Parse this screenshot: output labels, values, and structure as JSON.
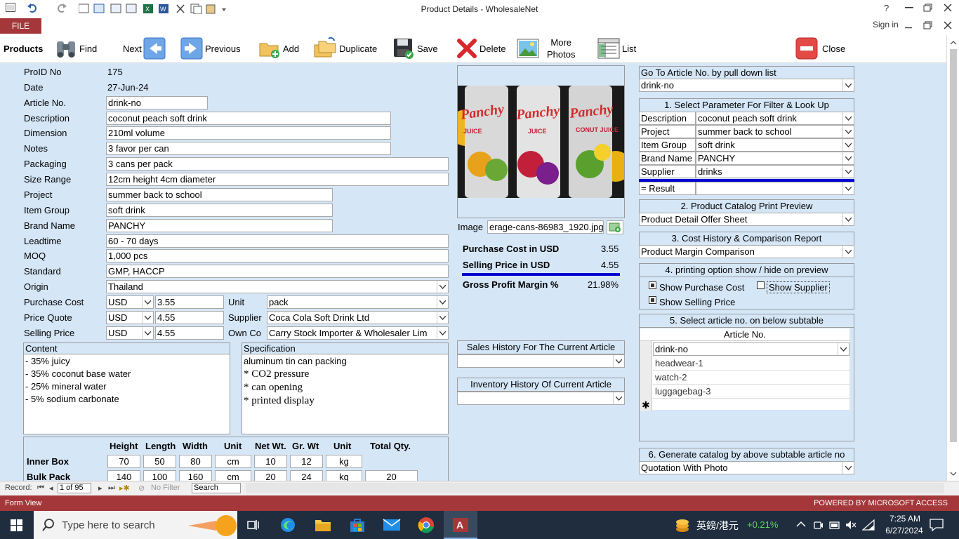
{
  "window": {
    "title": "Product Details - WholesaleNet",
    "help": "?",
    "signin": "Sign in",
    "file_tab": "FILE"
  },
  "toolbar": {
    "section": "Products",
    "find": "Find",
    "next": "Next",
    "previous": "Previous",
    "add": "Add",
    "duplicate": "Duplicate",
    "save": "Save",
    "delete": "Delete",
    "more_photos_1": "More",
    "more_photos_2": "Photos",
    "list": "List",
    "close": "Close"
  },
  "fields": {
    "proid_label": "ProID No",
    "proid": "175",
    "date_label": "Date",
    "date": "27-Jun-24",
    "article_label": "Article No.",
    "article": "drink-no",
    "description_label": "Description",
    "description": "coconut peach soft drink",
    "dimension_label": "Dimension",
    "dimension": "210ml volume",
    "notes_label": "Notes",
    "notes": "3 favor per can",
    "packaging_label": "Packaging",
    "packaging": "3 cans per pack",
    "size_label": "Size Range",
    "size": "12cm height 4cm diameter",
    "project_label": "Project",
    "project": "summer back to school",
    "itemgroup_label": "Item Group",
    "itemgroup": "soft drink",
    "brand_label": "Brand Name",
    "brand": "PANCHY",
    "leadtime_label": "Leadtime",
    "leadtime": "60 - 70 days",
    "moq_label": "MOQ",
    "moq": "1,000 pcs",
    "standard_label": "Standard",
    "standard": "GMP, HACCP",
    "origin_label": "Origin",
    "origin": "Thailand",
    "pcost_label": "Purchase Cost",
    "pcost_cur": "USD",
    "pcost": "3.55",
    "pquote_label": "Price Quote",
    "pquote_cur": "USD",
    "pquote": "4.55",
    "sprice_label": "Selling Price",
    "sprice_cur": "USD",
    "sprice": "4.55",
    "unit_label": "Unit",
    "unit": "pack",
    "supplier_label": "Supplier",
    "supplier": "Coca Cola Soft Drink Ltd",
    "ownco_label": "Own Co",
    "ownco": "Carry Stock Importer & Wholesaler Lim"
  },
  "content": {
    "title": "Content",
    "lines": [
      "- 35% juicy",
      "- 35% coconut base water",
      "- 25% mineral water",
      "- 5% sodium carbonate"
    ]
  },
  "spec": {
    "title": "Specification",
    "line0": "aluminum tin can packing",
    "lines": [
      "* CO2 pressure",
      "* can opening",
      "* printed display"
    ]
  },
  "dims": {
    "headers": [
      "Height",
      "Length",
      "Width",
      "Unit",
      "Net Wt.",
      "Gr. Wt",
      "Unit",
      "Total Qty."
    ],
    "inner_label": "Inner Box",
    "inner": [
      "70",
      "50",
      "80",
      "cm",
      "10",
      "12",
      "kg",
      ""
    ],
    "bulk_label": "Bulk Pack",
    "bulk": [
      "140",
      "100",
      "160",
      "cm",
      "20",
      "24",
      "kg",
      "20"
    ]
  },
  "image": {
    "label": "Image",
    "filename": "erage-cans-86983_1920.jpg",
    "brand_text": "Panchy",
    "juice_text": "JUICE",
    "coco_text": "CONUT JUICE"
  },
  "margin": {
    "pcost_label": "Purchase Cost in USD",
    "pcost": "3.55",
    "sprice_label": "Selling Price in USD",
    "sprice": "4.55",
    "gpm_label": "Gross Profit Margin %",
    "gpm": "21.98%"
  },
  "history": {
    "sales": "Sales History For The Current Article",
    "inventory": "Inventory History Of Current Article"
  },
  "right": {
    "goto_title": "Go To Article No. by pull down list",
    "goto_value": "drink-no",
    "filter_title": "1. Select Parameter For Filter & Look Up",
    "filter": [
      {
        "label": "Description",
        "value": "coconut peach soft drink"
      },
      {
        "label": "Project",
        "value": "summer back to school"
      },
      {
        "label": "Item Group",
        "value": "soft drink"
      },
      {
        "label": "Brand Name",
        "value": "PANCHY"
      },
      {
        "label": "Supplier",
        "value": "drinks"
      }
    ],
    "result_label": "= Result",
    "catalog_title": "2. Product Catalog Print Preview",
    "catalog_value": "Product Detail Offer Sheet",
    "cost_title": "3. Cost History & Comparison Report",
    "cost_value": "Product Margin Comparison",
    "print_title": "4. printing option show / hide on preview",
    "show_pcost": "Show Purchase Cost",
    "show_supplier": "Show Supplier",
    "show_sprice": "Show Selling Price",
    "sub_title": "5. Select article no.  on below subtable",
    "sub_header": "Article No.",
    "sub_rows": [
      "drink-no",
      "headwear-1",
      "watch-2",
      "luggagebag-3"
    ],
    "gen_title": "6. Generate catalog by above subtable article no",
    "gen_value": "Quotation With Photo"
  },
  "record": {
    "label": "Record:",
    "position": "1 of 95",
    "nofilter": "No Filter",
    "search": "Search"
  },
  "status": {
    "left": "Form View",
    "right": "POWERED BY MICROSOFT ACCESS"
  },
  "taskbar": {
    "search": "Type here to search",
    "ime": "英鎊/港元",
    "change": "+0.21%",
    "time": "7:25 AM",
    "date": "6/27/2024"
  },
  "colors": {
    "accent": "#a4373a",
    "form_bg": "#d5e6f7",
    "divider": "#0000d0",
    "positive": "#5fd35f"
  }
}
